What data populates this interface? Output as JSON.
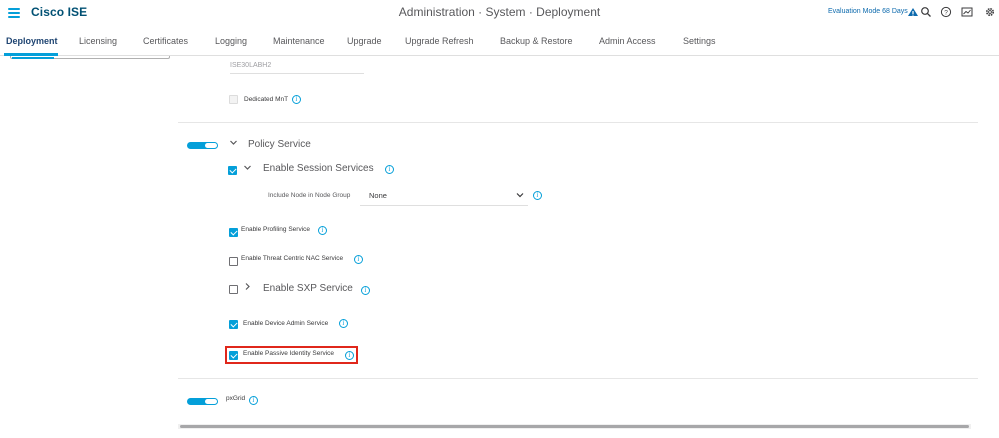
{
  "header": {
    "brand": "Cisco ISE",
    "title": "Administration · System · Deployment",
    "evaluation": "Evaluation Mode 68 Days",
    "icons": [
      "alert-icon",
      "search-icon",
      "help-icon",
      "dashboard-icon",
      "gear-icon"
    ]
  },
  "tabs": [
    {
      "label": "Deployment",
      "active": true
    },
    {
      "label": "Licensing"
    },
    {
      "label": "Certificates"
    },
    {
      "label": "Logging"
    },
    {
      "label": "Maintenance"
    },
    {
      "label": "Upgrade"
    },
    {
      "label": "Upgrade Refresh"
    },
    {
      "label": "Backup & Restore"
    },
    {
      "label": "Admin Access"
    },
    {
      "label": "Settings"
    }
  ],
  "form": {
    "node_name_value": "ISE30LABH2",
    "dedicated_mnt_label": "Dedicated MnT",
    "policy_service": {
      "label": "Policy Service",
      "enabled": true,
      "session_services_label": "Enable Session Services",
      "session_services_checked": true,
      "node_group_label": "Include Node in Node Group",
      "node_group_value": "None",
      "profiling_label": "Enable Profiling Service",
      "profiling_checked": true,
      "threat_label": "Enable Threat Centric NAC Service",
      "threat_checked": false,
      "sxp_label": "Enable SXP Service",
      "sxp_checked": false,
      "device_admin_label": "Enable Device Admin Service",
      "device_admin_checked": true,
      "passive_identity_label": "Enable Passive Identity Service",
      "passive_identity_checked": true
    },
    "pxgrid": {
      "label": "pxGrid",
      "enabled": true
    }
  },
  "colors": {
    "accent": "#049fd9",
    "brand": "#005073",
    "highlight": "#e0271b"
  }
}
